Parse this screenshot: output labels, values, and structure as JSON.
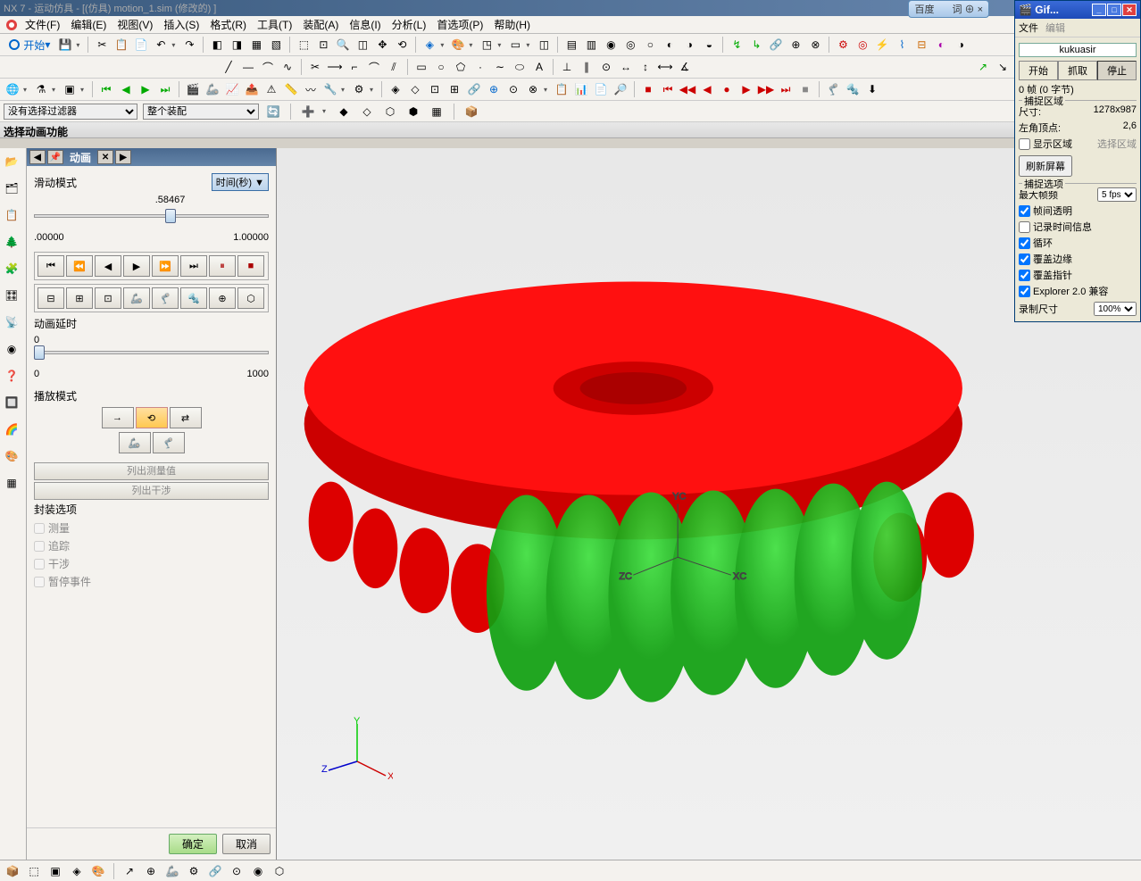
{
  "app": {
    "title": "NX 7 - 运动仿具 - [(仿具) motion_1.sim (修改的) ]"
  },
  "floater": {
    "label1": "百度",
    "label2": "词 ⊕ ×"
  },
  "menu": [
    "文件(F)",
    "编辑(E)",
    "视图(V)",
    "插入(S)",
    "格式(R)",
    "工具(T)",
    "装配(A)",
    "信息(I)",
    "分析(L)",
    "首选项(P)",
    "帮助(H)"
  ],
  "start_btn": "开始",
  "filter1": "没有选择过滤器",
  "filter2": "整个装配",
  "prompt": "选择动画功能",
  "panel": {
    "title": "动画",
    "slide_mode": "滑动模式",
    "slide_mode_val": "时间(秒)",
    "cur": ".58467",
    "min": ".00000",
    "max": "1.00000",
    "delay": "动画延时",
    "delay_min": "0",
    "delay_max": "1000",
    "delay_cur": "0",
    "play_mode": "播放模式",
    "list_measure": "列出测量值",
    "list_interf": "列出干涉",
    "pack_opts": "封装选项",
    "chk_measure": "测量",
    "chk_track": "追踪",
    "chk_interf": "干涉",
    "chk_pause": "暂停事件",
    "ok": "确定",
    "cancel": "取消"
  },
  "triad": {
    "x": "X",
    "y": "Y",
    "z": "Z",
    "xc": "XC",
    "yc": "YC",
    "zc": "ZC"
  },
  "gif": {
    "title": "Gif...",
    "menu_file": "文件",
    "menu_edit": "编辑",
    "name": "kukuasir",
    "btn_start": "开始",
    "btn_grab": "抓取",
    "btn_stop": "停止",
    "frames": "0 帧 (0 字节)",
    "capture_area": "捕捉区域",
    "size_label": "尺寸:",
    "size_val": "1278x987",
    "corner_label": "左角顶点:",
    "corner_val": "2,6",
    "show_area": "显示区域",
    "select_area": "选择区域",
    "refresh": "刷新屏幕",
    "capture_opts": "捕捉选项",
    "max_fps_label": "最大帧频",
    "max_fps_val": "5 fps",
    "chk_trans": "帧间透明",
    "chk_time": "记录时间信息",
    "chk_loop": "循环",
    "chk_edge": "覆盖边缘",
    "chk_ptr": "覆盖指针",
    "chk_explorer": "Explorer 2.0 兼容",
    "rec_size_label": "录制尺寸",
    "rec_size_val": "100%"
  }
}
